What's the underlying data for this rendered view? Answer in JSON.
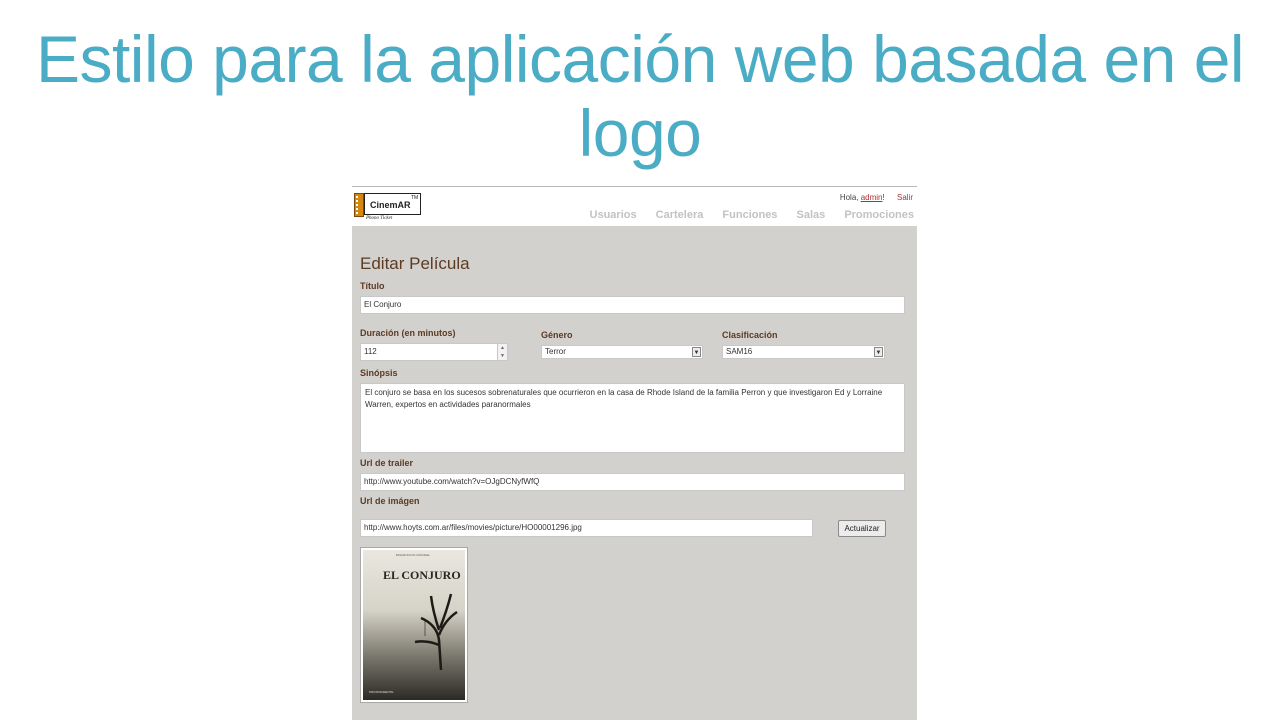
{
  "slide": {
    "title": "Estilo para la aplicación web basada en el logo"
  },
  "header": {
    "logo_name": "CinemAR",
    "logo_tm": "TM",
    "logo_sub": "Phono Ticket",
    "greeting_prefix": "Hola, ",
    "user": "admin",
    "greeting_suffix": "!",
    "logout": "Salir"
  },
  "nav": {
    "items": [
      "Usuarios",
      "Cartelera",
      "Funciones",
      "Salas",
      "Promociones"
    ]
  },
  "form": {
    "heading": "Editar Película",
    "titulo": {
      "label": "Título",
      "value": "El Conjuro"
    },
    "duracion": {
      "label": "Duración (en minutos)",
      "value": "112"
    },
    "genero": {
      "label": "Género",
      "value": "Terror"
    },
    "clasificacion": {
      "label": "Clasificación",
      "value": "SAM16"
    },
    "sinopsis": {
      "label": "Sinópsis",
      "value": "El conjuro se basa en los sucesos sobrenaturales que ocurrieron en la casa de Rhode Island de la familia Perron y que investigaron Ed y Lorraine Warren, expertos en actividades paranormales"
    },
    "trailer": {
      "label": "Url de trailer",
      "value": "http://www.youtube.com/watch?v=OJgDCNyfWfQ"
    },
    "imagen": {
      "label": "Url de imágen",
      "value": "http://www.hoyts.com.ar/files/movies/picture/HO00001296.jpg"
    },
    "update_button": "Actualizar"
  },
  "poster": {
    "title": "EL CONJURO",
    "tagline": "BASADO EN UN CASO REAL",
    "footer": "PROXIMAMENTE"
  },
  "colors": {
    "title": "#4bacc6",
    "heading": "#5c3b22",
    "panel": "#d3d1ce",
    "nav": "#c2c2c2",
    "link": "#b03030"
  }
}
